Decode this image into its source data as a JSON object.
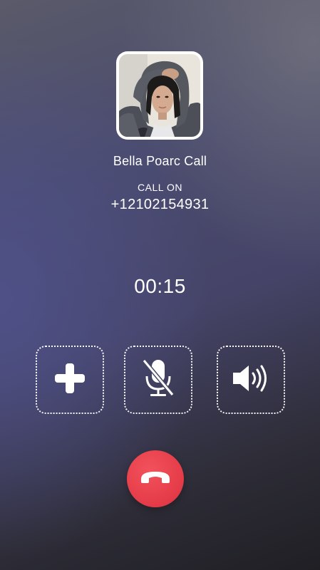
{
  "contact": {
    "name": "Bella Poarc Call",
    "status": "CALL ON",
    "number": "+12102154931"
  },
  "call": {
    "duration": "00:15"
  },
  "actions": [
    {
      "id": "add",
      "icon": "plus-icon"
    },
    {
      "id": "mute",
      "icon": "microphone-muted-icon"
    },
    {
      "id": "speaker",
      "icon": "speaker-icon"
    }
  ],
  "end_call": {
    "icon": "hang-up-phone-icon",
    "color": "#e63e4a"
  },
  "colors": {
    "text": "#ffffff",
    "background_start": "#5a5a6a",
    "background_end": "#1f1f24"
  }
}
